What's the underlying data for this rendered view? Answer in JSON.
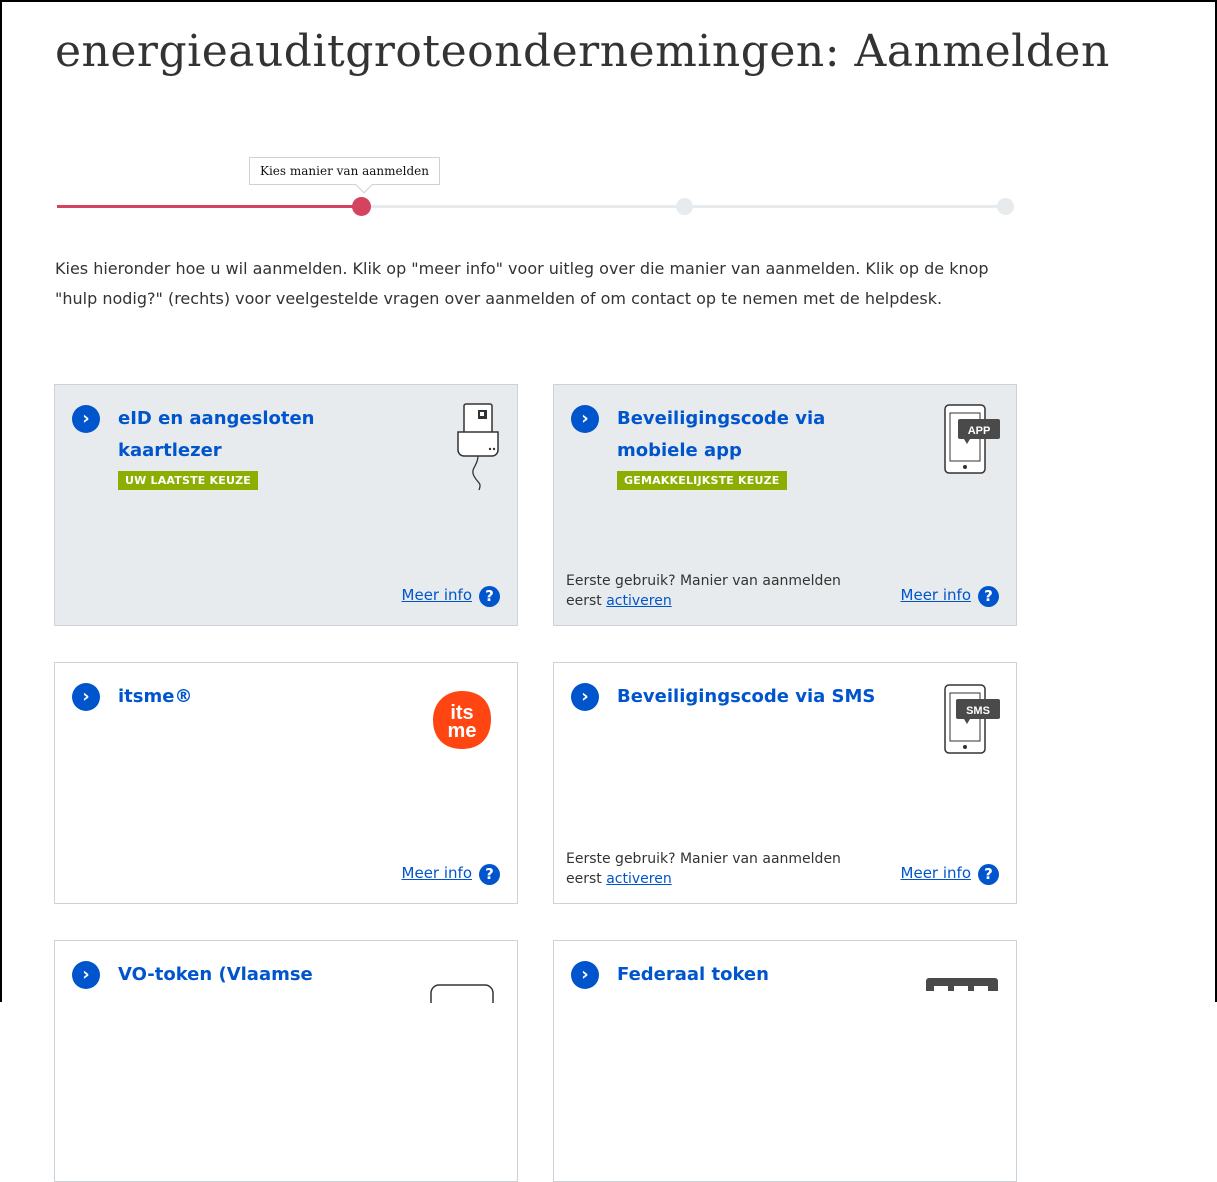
{
  "page": {
    "title": "energieauditgroteondernemingen: Aanmelden"
  },
  "progress": {
    "tooltip": "Kies manier van aanmelden",
    "current_step": 1,
    "total_steps": 3
  },
  "intro": "Kies hieronder hoe u wil aanmelden. Klik op \"meer info\" voor uitleg over die manier van aanmelden. Klik op de knop \"hulp nodig?\" (rechts) voor veelgestelde vragen over aanmelden of om contact op te nemen met de helpdesk.",
  "cards": [
    {
      "title": "eID en aangesloten kaartlezer",
      "badge": "UW LAATSTE KEUZE",
      "meer_info": "Meer info",
      "icon": "card-reader-icon"
    },
    {
      "title": "Beveiligingscode via mobiele app",
      "badge": "GEMAKKELIJKSTE KEUZE",
      "first_use_text": "Eerste gebruik? Manier van aanmelden eerst",
      "activate_link": "activeren",
      "meer_info": "Meer info",
      "icon": "mobile-app-icon",
      "icon_label": "APP"
    },
    {
      "title": "itsme®",
      "meer_info": "Meer info",
      "icon": "itsme-logo",
      "logo_text_top": "its",
      "logo_text_bottom": "me"
    },
    {
      "title": "Beveiligingscode via SMS",
      "first_use_text": "Eerste gebruik? Manier van aanmelden eerst",
      "activate_link": "activeren",
      "meer_info": "Meer info",
      "icon": "sms-phone-icon",
      "icon_label": "SMS"
    },
    {
      "title": "VO-token (Vlaamse",
      "icon": "token-icon"
    },
    {
      "title": "Federaal token",
      "icon": "federal-token-icon"
    }
  ],
  "colors": {
    "accent_blue": "#0055cc",
    "progress_red": "#d2445f",
    "badge_green": "#8bae00",
    "card_gray": "#e8ebee",
    "itsme_orange": "#ff4612"
  }
}
